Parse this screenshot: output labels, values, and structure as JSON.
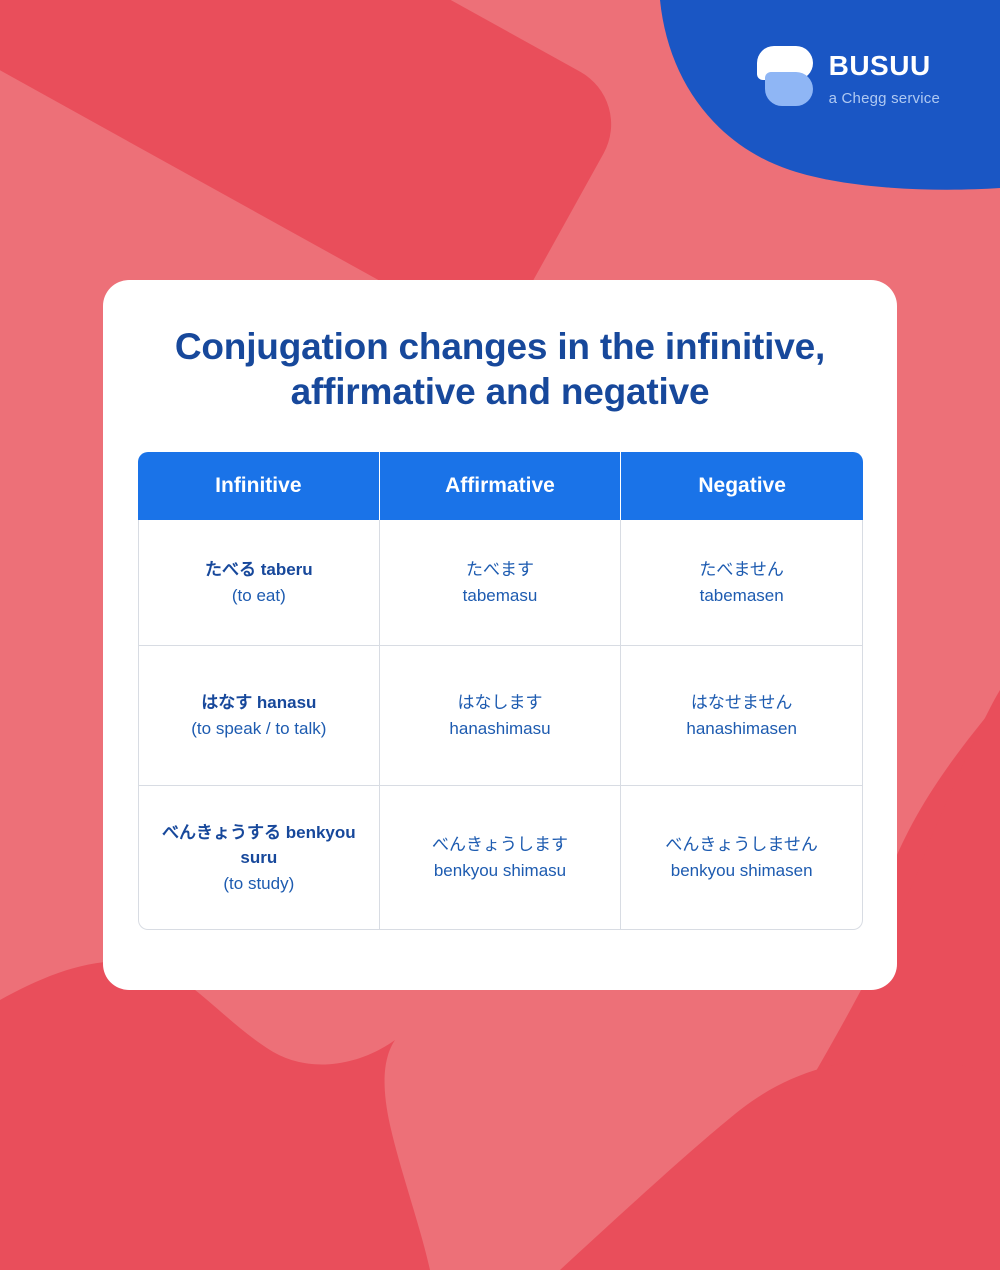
{
  "brand": {
    "logo_icon": "busuu-speech-bubble-icon",
    "name": "Busuu",
    "tagline": "a Chegg service",
    "blob_color": "#1A56C4",
    "logo_white": "#FFFFFF",
    "logo_light_blue": "#8FB6F5"
  },
  "background": {
    "base_color": "#ED7078",
    "accent_color": "#E94E5B"
  },
  "card": {
    "title": "Conjugation changes in the infinitive, affirmative and negative",
    "title_color": "#17489B",
    "background": "#FFFFFF"
  },
  "table": {
    "header_color": "#1A73E8",
    "header_text_color": "#FFFFFF",
    "body_text_color": "#1D5BB0",
    "border_color": "#D8DCE3",
    "columns": [
      "Infinitive",
      "Affirmative",
      "Negative"
    ],
    "rows": [
      {
        "infinitive_term": "たべる taberu",
        "infinitive_gloss": "(to eat)",
        "affirmative_jp": "たべます",
        "affirmative_ro": "tabemasu",
        "negative_jp": "たべません",
        "negative_ro": "tabemasen"
      },
      {
        "infinitive_term": "はなす hanasu",
        "infinitive_gloss": "(to speak / to talk)",
        "affirmative_jp": "はなします",
        "affirmative_ro": "hanashimasu",
        "negative_jp": "はなせません",
        "negative_ro": "hanashimasen"
      },
      {
        "infinitive_term": "べんきょうする benkyou suru",
        "infinitive_gloss": "(to study)",
        "affirmative_jp": "べんきょうします",
        "affirmative_ro": "benkyou shimasu",
        "negative_jp": "べんきょうしません",
        "negative_ro": "benkyou shimasen"
      }
    ]
  }
}
